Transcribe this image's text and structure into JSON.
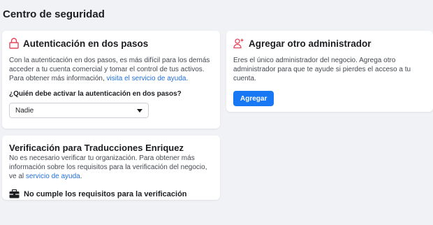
{
  "page": {
    "title": "Centro de seguridad"
  },
  "two_factor": {
    "title": "Autenticación en dos pasos",
    "description": "Con la autenticación en dos pasos, es más difícil para los demás acceder a tu cuenta comercial y tomar el control de tus activos. Para obtener más información, ",
    "help_link": "visita el servicio de ayuda",
    "description_end": ".",
    "question": "¿Quién debe activar la autenticación en dos pasos?",
    "select_value": "Nadie",
    "icon": "lock-icon",
    "accent_color": "#e4455b"
  },
  "admin": {
    "title": "Agregar otro administrador",
    "description": "Eres el único administrador del negocio. Agrega otro administrador para que te ayude si pierdes el acceso a tu cuenta.",
    "button_label": "Agregar",
    "icon": "add-person-icon",
    "button_color": "#1877f2"
  },
  "verification": {
    "title": "Verificación para Traducciones Enriquez",
    "description": "No es necesario verificar tu organización. Para obtener más información sobre los requisitos para la verificación del negocio, ve al ",
    "help_link": "servicio de ayuda",
    "description_end": ".",
    "status": "No cumple los requisitos para la verificación",
    "icon": "briefcase-icon"
  }
}
